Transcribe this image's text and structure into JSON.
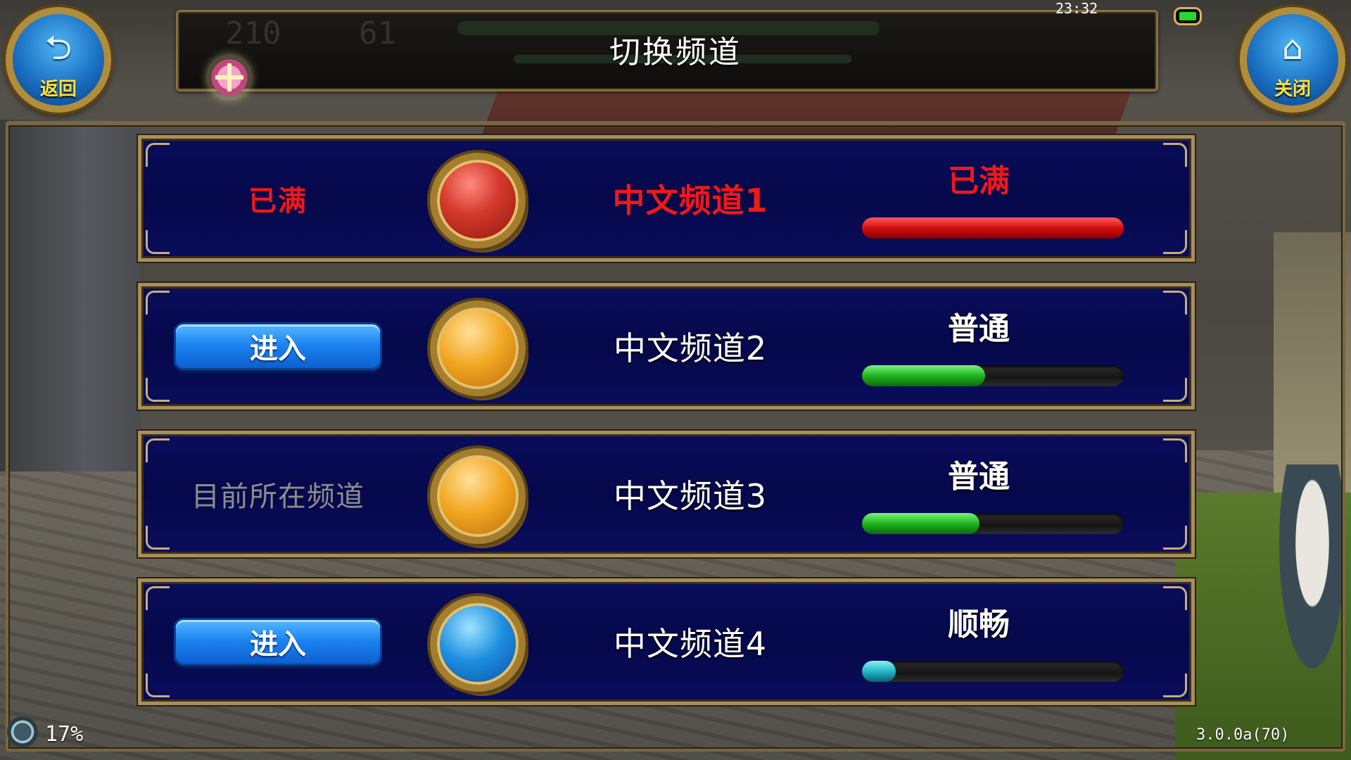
{
  "header": {
    "title": "切换频道",
    "time": "23:32",
    "ghost_values": [
      "210",
      "61"
    ]
  },
  "nav": {
    "back_label": "返回",
    "close_label": "关闭",
    "back_icon": "back-arrow-icon",
    "close_icon": "home-icon"
  },
  "channels": [
    {
      "name": "中文频道1",
      "action_text": "已满",
      "action_type": "status-full",
      "load_label": "已满",
      "load_fraction": 1.0,
      "orb_color": "red",
      "accent": "#f01818"
    },
    {
      "name": "中文频道2",
      "action_text": "进入",
      "action_type": "enter-button",
      "load_label": "普通",
      "load_fraction": 0.47,
      "orb_color": "orange",
      "accent": "#1fb51f"
    },
    {
      "name": "中文频道3",
      "action_text": "目前所在频道",
      "action_type": "current",
      "load_label": "普通",
      "load_fraction": 0.45,
      "orb_color": "orange",
      "accent": "#1fb51f"
    },
    {
      "name": "中文频道4",
      "action_text": "进入",
      "action_type": "enter-button",
      "load_label": "顺畅",
      "load_fraction": 0.13,
      "orb_color": "blue",
      "accent": "#22b8c8"
    }
  ],
  "footer": {
    "percent": "17%",
    "version": "3.0.0a(70)"
  }
}
